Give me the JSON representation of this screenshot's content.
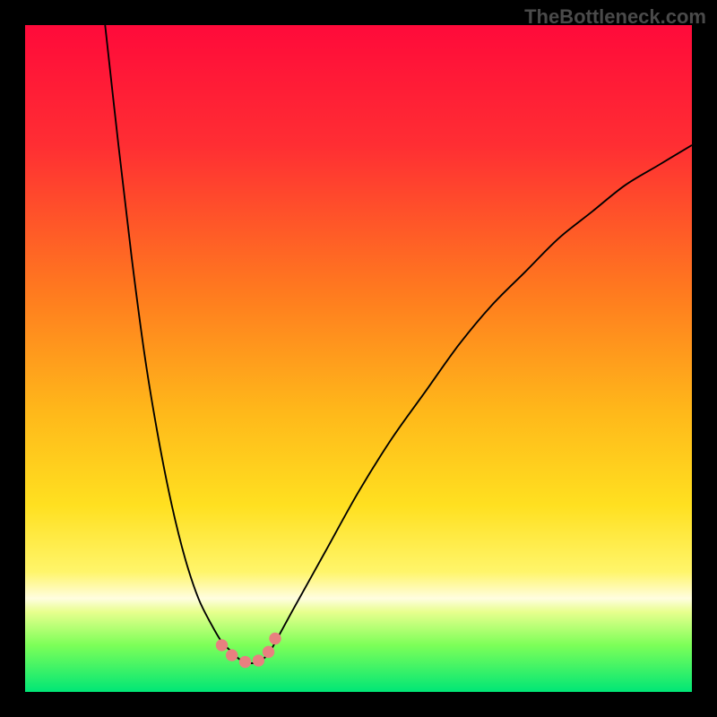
{
  "watermark": "TheBottleneck.com",
  "chart_data": {
    "type": "line",
    "title": "",
    "xlabel": "",
    "ylabel": "",
    "xlim": [
      0,
      100
    ],
    "ylim": [
      0,
      100
    ],
    "gradient_stops": [
      {
        "offset": 0,
        "color": "#ff0a3a"
      },
      {
        "offset": 18,
        "color": "#ff2e33"
      },
      {
        "offset": 40,
        "color": "#ff7a1f"
      },
      {
        "offset": 58,
        "color": "#ffb81a"
      },
      {
        "offset": 72,
        "color": "#ffe020"
      },
      {
        "offset": 82,
        "color": "#fff56a"
      },
      {
        "offset": 86,
        "color": "#fffde0"
      },
      {
        "offset": 88,
        "color": "#e8ff8e"
      },
      {
        "offset": 93,
        "color": "#7cff58"
      },
      {
        "offset": 100,
        "color": "#00e676"
      }
    ],
    "series": [
      {
        "name": "curve-left",
        "x": [
          12,
          14,
          16,
          18,
          20,
          22,
          24,
          26,
          28,
          29.5,
          31
        ],
        "y": [
          0,
          18,
          35,
          50,
          62,
          72,
          80,
          86,
          90,
          92.5,
          94
        ]
      },
      {
        "name": "curve-bottom",
        "x": [
          31,
          32,
          33,
          34,
          35,
          36,
          37
        ],
        "y": [
          94,
          95,
          95.5,
          95.7,
          95.5,
          94.8,
          93.5
        ]
      },
      {
        "name": "curve-right",
        "x": [
          37,
          40,
          45,
          50,
          55,
          60,
          65,
          70,
          75,
          80,
          85,
          90,
          95,
          100
        ],
        "y": [
          93.5,
          88,
          79,
          70,
          62,
          55,
          48,
          42,
          37,
          32,
          28,
          24,
          21,
          18
        ]
      }
    ],
    "markers": {
      "name": "bottom-points",
      "color": "#e88080",
      "x": [
        29.5,
        31,
        33,
        35,
        36.5,
        37.5
      ],
      "y": [
        93,
        94.5,
        95.5,
        95.3,
        94,
        92
      ]
    }
  }
}
